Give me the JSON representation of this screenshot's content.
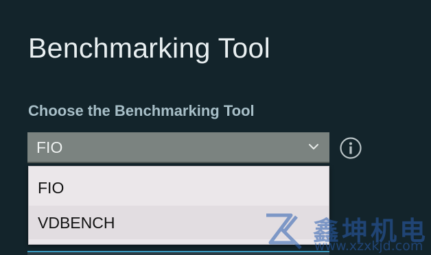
{
  "page": {
    "title": "Benchmarking Tool"
  },
  "form": {
    "label": "Choose the Benchmarking Tool",
    "select": {
      "selected_value": "FIO",
      "expanded": true,
      "options": [
        {
          "label": "FIO"
        },
        {
          "label": "VDBENCH"
        }
      ]
    },
    "info_icon": "info-circle-icon"
  },
  "watermark": {
    "text": "鑫坤机电",
    "url": "www.xzxkjd.com",
    "icon": "xz-logo"
  },
  "colors": {
    "background": "#13242b",
    "title": "#e9eff1",
    "label": "#a8bfc8",
    "select_bg": "#7b8380",
    "dropdown_bg": "#ebe7ea",
    "accent": "#3a9bc1",
    "watermark": "#2b5fb0"
  }
}
